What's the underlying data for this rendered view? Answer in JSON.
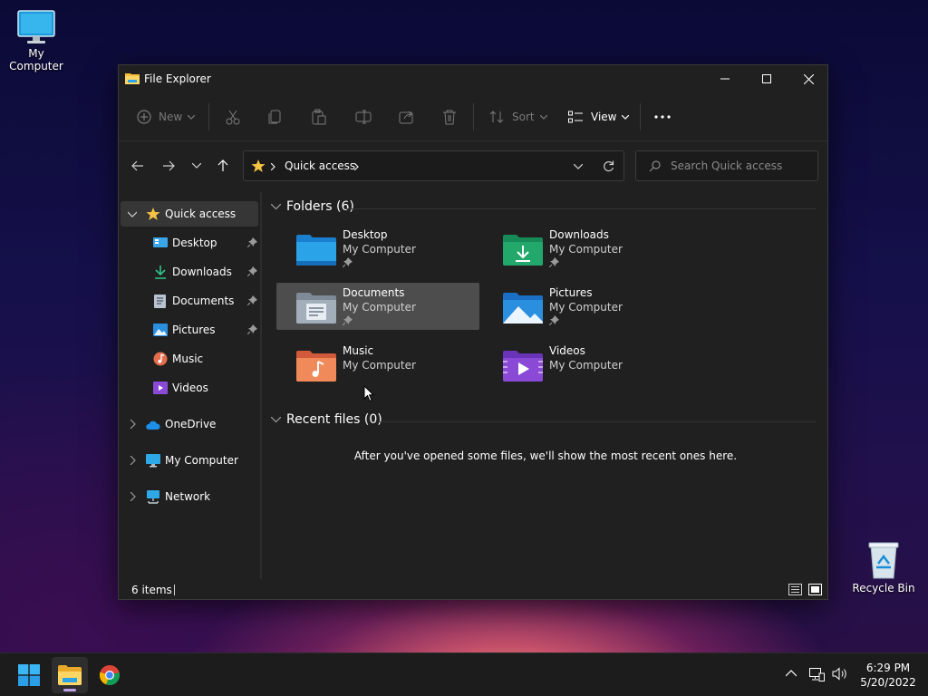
{
  "desktop": {
    "my_computer_label": "My Computer",
    "recycle_bin_label": "Recycle Bin"
  },
  "window": {
    "title": "File Explorer"
  },
  "toolbar": {
    "new_label": "New",
    "sort_label": "Sort",
    "view_label": "View"
  },
  "address": {
    "location": "Quick access"
  },
  "search": {
    "placeholder": "Search Quick access"
  },
  "sidebar": {
    "quick_access": "Quick access",
    "items": [
      {
        "label": "Desktop",
        "icon": "desktop-icon",
        "pinned": true
      },
      {
        "label": "Downloads",
        "icon": "downloads-icon",
        "pinned": true
      },
      {
        "label": "Documents",
        "icon": "documents-icon",
        "pinned": true
      },
      {
        "label": "Pictures",
        "icon": "pictures-icon",
        "pinned": true
      },
      {
        "label": "Music",
        "icon": "music-icon",
        "pinned": false
      },
      {
        "label": "Videos",
        "icon": "videos-icon",
        "pinned": false
      }
    ],
    "onedrive": "OneDrive",
    "my_computer": "My Computer",
    "network": "Network"
  },
  "content": {
    "folders_header": "Folders (6)",
    "folders": [
      {
        "name": "Desktop",
        "location": "My Computer",
        "pinned": true
      },
      {
        "name": "Downloads",
        "location": "My Computer",
        "pinned": true
      },
      {
        "name": "Documents",
        "location": "My Computer",
        "pinned": true
      },
      {
        "name": "Pictures",
        "location": "My Computer",
        "pinned": true
      },
      {
        "name": "Music",
        "location": "My Computer",
        "pinned": false
      },
      {
        "name": "Videos",
        "location": "My Computer",
        "pinned": false
      }
    ],
    "recent_header": "Recent files (0)",
    "recent_empty": "After you've opened some files, we'll show the most recent ones here."
  },
  "status": {
    "items_count": "6 items"
  },
  "taskbar": {
    "time": "6:29 PM",
    "date": "5/20/2022"
  },
  "colors": {
    "accent": "#0078d4",
    "folder_blue": "#2aa3e8",
    "folder_green": "#22a86b",
    "folder_yellow": "#f3c03b",
    "window_bg": "#202020"
  }
}
